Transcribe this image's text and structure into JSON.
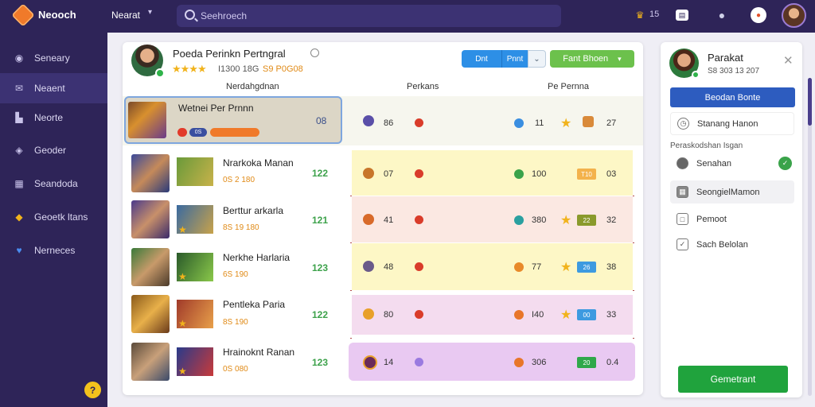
{
  "topbar": {
    "brand": "Neooch",
    "workspace": "Nearat",
    "search_placeholder": "Seehroech",
    "notif_count": "15"
  },
  "sidebar": {
    "items": [
      {
        "label": "Seneary",
        "icon": "dashboard-icon"
      },
      {
        "label": "Neaent",
        "icon": "send-icon"
      },
      {
        "label": "Neorte",
        "icon": "chart-icon"
      },
      {
        "label": "Geoder",
        "icon": "gem-icon"
      },
      {
        "label": "Seandoda",
        "icon": "calendar-icon"
      },
      {
        "label": "Geoetk ltans",
        "icon": "chat-icon"
      },
      {
        "label": "Nerneces",
        "icon": "heart-icon"
      }
    ],
    "help": "?"
  },
  "main": {
    "title": "Poeda Perinkn Pertngral",
    "meta": "I1300 18G",
    "meta2": "S9 P0G08",
    "btn1": "Dnt",
    "btn2": "Pnnt",
    "btn3": "Fant Bhoen",
    "columns": [
      "Nerdahgdnan",
      "Perkans",
      "Pe Pernna"
    ],
    "selected": {
      "name": "Wetnei Per Prnnn",
      "pill": "0S",
      "code": "08",
      "val1": "86",
      "val2": "11",
      "val3": "27"
    },
    "rows": [
      {
        "name": "Nrarkoka Manan",
        "sub": "0S 2 180",
        "code": "122",
        "a": "07",
        "b": "100",
        "badge": "T10",
        "c": "03",
        "bg": "#fdf7c6",
        "badgecolor": "#f3b24c"
      },
      {
        "name": "Berttur arkarla",
        "sub": "8S 19 180",
        "code": "121",
        "a": "41",
        "b": "380",
        "badge": "22",
        "c": "32",
        "bg": "#fbe8e2",
        "badgecolor": "#8a9a2c"
      },
      {
        "name": "Nerkhe Harlaria",
        "sub": "6S 190",
        "code": "123",
        "a": "48",
        "b": "77",
        "badge": "26",
        "c": "38",
        "bg": "#fdf7c6",
        "badgecolor": "#3d9ae0"
      },
      {
        "name": "Pentleka Paria",
        "sub": "8S 190",
        "code": "122",
        "a": "80",
        "b": "I40",
        "badge": "00",
        "c": "33",
        "bg": "#f4dcef",
        "badgecolor": "#3d9ae0"
      },
      {
        "name": "Hrainoknt Ranan",
        "sub": "0S 080",
        "code": "123",
        "a": "14",
        "b": "306",
        "badge": "20",
        "c": "0.4",
        "bg": "#e9c9f2",
        "badgecolor": "#2fa84a"
      }
    ]
  },
  "panel": {
    "name": "Parakat",
    "sub": "S8 303 13 207",
    "button": "Beodan Bonte",
    "item1": "Stanang Hanon",
    "hint": "Peraskodshan Isgan",
    "item2": "Senahan",
    "item3": "SeongielMamon",
    "item4": "Pemoot",
    "item5": "Sach Belolan",
    "cta": "Gemetrant"
  }
}
